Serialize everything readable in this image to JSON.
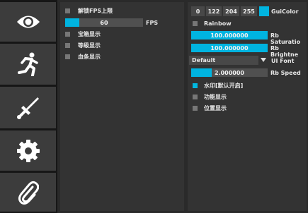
{
  "sidebar": {
    "items": [
      {
        "name": "eye-icon"
      },
      {
        "name": "running-person-icon"
      },
      {
        "name": "sword-icon"
      },
      {
        "name": "gear-icon"
      },
      {
        "name": "paperclip-icon"
      }
    ]
  },
  "left_panel": {
    "unlock_fps_label": "解锁FPS上限",
    "fps_slider": {
      "value_text": "60",
      "fill": 0.18,
      "label": "FPS"
    },
    "chest_esp_label": "宝箱显示",
    "level_esp_label": "等级显示",
    "health_bar_label": "血条显示"
  },
  "right_panel": {
    "gui_color": {
      "r": "0",
      "g": "122",
      "b": "204",
      "a": "255",
      "label": "GuiColor",
      "swatch": "#00b4e0"
    },
    "rainbow_label": "Rainbow",
    "rb_saturation": {
      "value_text": "100.000000",
      "fill": 1.0,
      "label": "Rb Saturatio"
    },
    "rb_brightness": {
      "value_text": "100.000000",
      "fill": 1.0,
      "label": "Rb Brightne"
    },
    "ui_font": {
      "selected": "Default",
      "label": "UI Font"
    },
    "rb_speed": {
      "value_text": "2.000000",
      "fill": 0.27,
      "label": "Rb Speed"
    },
    "watermark_label": "水印[默认开启]",
    "watermark_checked": true,
    "feature_display_label": "功能显示",
    "position_display_label": "位置显示"
  },
  "colors": {
    "accent": "#00b4e0",
    "panel": "#333333",
    "sidebar": "#161616"
  }
}
